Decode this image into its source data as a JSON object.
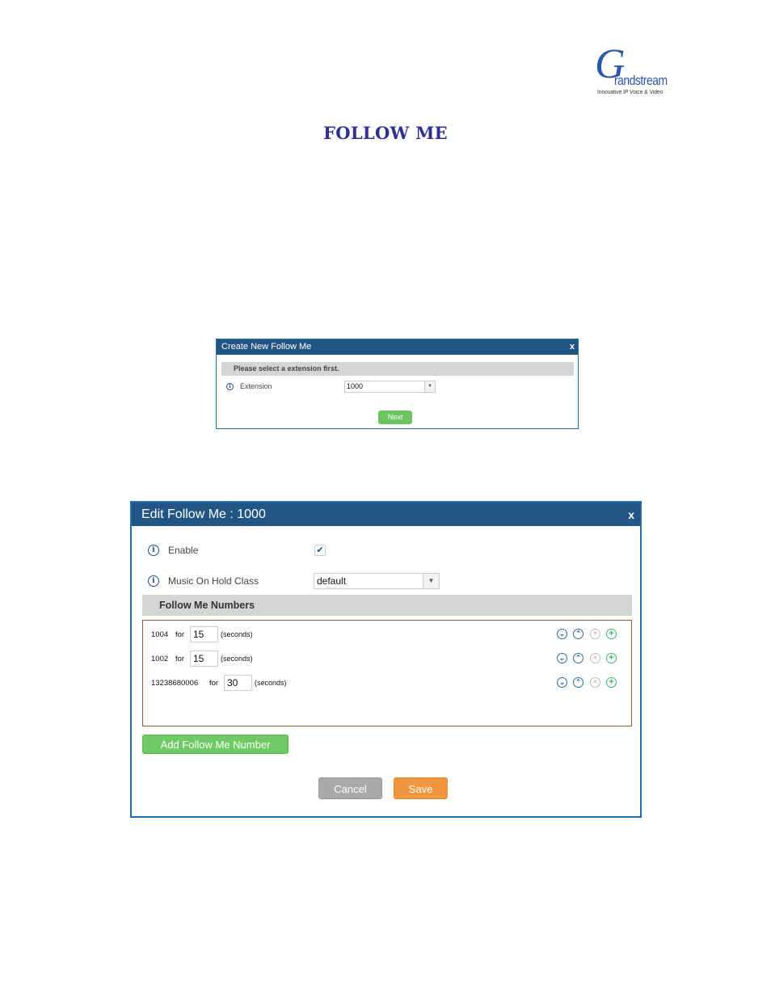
{
  "logo": {
    "brand_initial": "G",
    "brand_rest": "randstream",
    "tagline": "Innovative IP Voice & Video"
  },
  "page_title": "FOLLOW ME",
  "create_dialog": {
    "title": "Create New Follow Me",
    "close": "x",
    "notice": "Please select a extension first.",
    "extension_label": "Extension",
    "extension_value": "1000",
    "next_label": "Next"
  },
  "edit_dialog": {
    "title": "Edit Follow Me : 1000",
    "close": "x",
    "enable_label": "Enable",
    "enable_checked": true,
    "moh_label": "Music On Hold Class",
    "moh_value": "default",
    "section_title": "Follow Me Numbers",
    "rows": [
      {
        "number": "1004",
        "for": "for",
        "seconds": "15",
        "unit": "(seconds)"
      },
      {
        "number": "1002",
        "for": "for",
        "seconds": "15",
        "unit": "(seconds)"
      },
      {
        "number": "13238680006",
        "for": "for",
        "seconds": "30",
        "unit": "(seconds)"
      }
    ],
    "icons": {
      "down": "⌄",
      "up": "⌃",
      "delete": "×",
      "add": "+"
    },
    "add_label": "Add Follow Me Number",
    "cancel_label": "Cancel",
    "save_label": "Save"
  }
}
